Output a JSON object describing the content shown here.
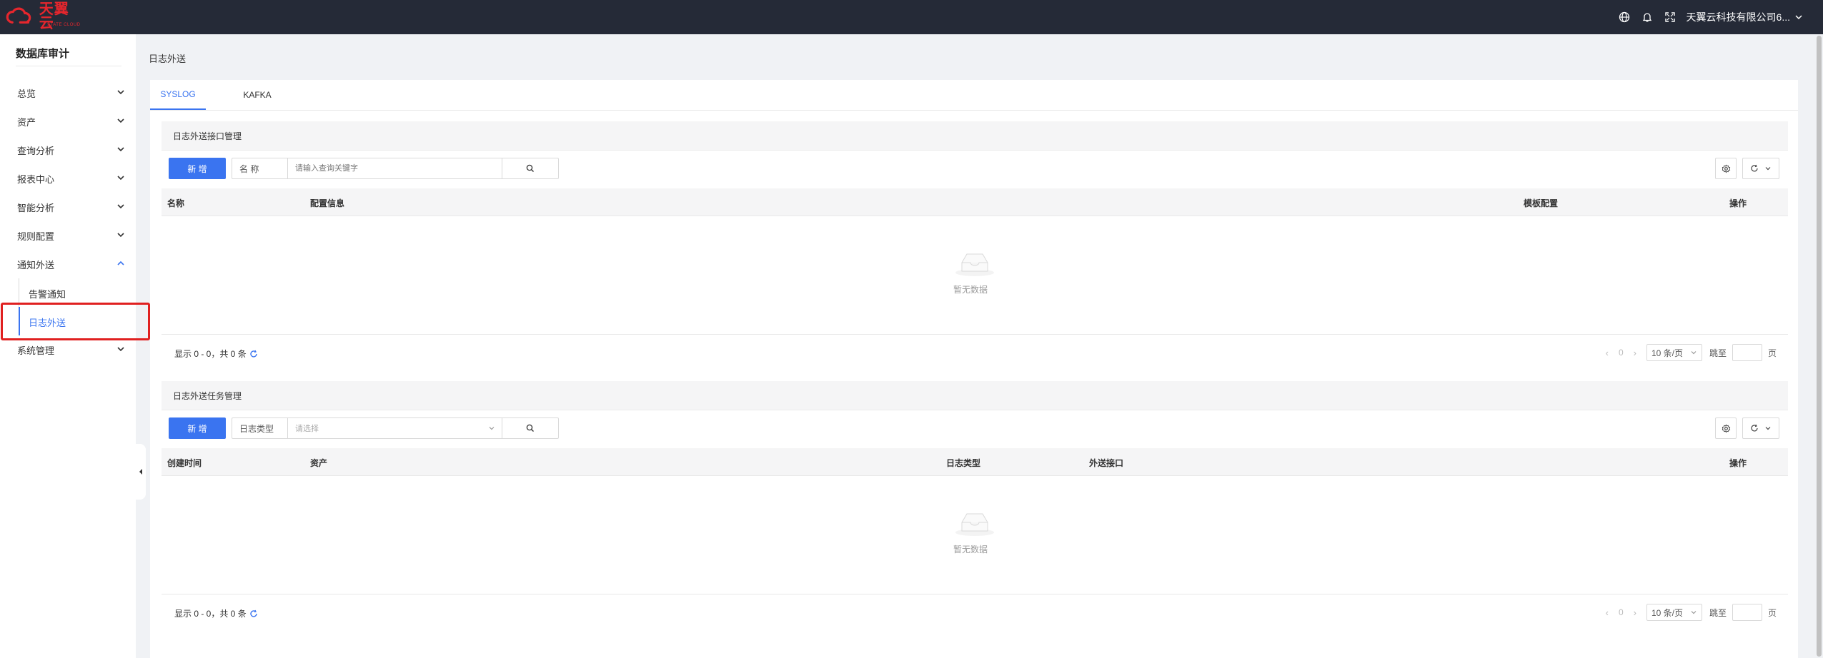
{
  "brand": {
    "name": "天翼云",
    "subtitle": "STATE CLOUD"
  },
  "topbar": {
    "user": "天翼云科技有限公司6...",
    "icons": [
      "globe-icon",
      "bell-icon",
      "fullscreen-icon"
    ]
  },
  "sidebar": {
    "title": "数据库审计",
    "items": [
      {
        "label": "总览"
      },
      {
        "label": "资产"
      },
      {
        "label": "查询分析"
      },
      {
        "label": "报表中心"
      },
      {
        "label": "智能分析"
      },
      {
        "label": "规则配置"
      },
      {
        "label": "通知外送",
        "expanded": true
      },
      {
        "label": "系统管理"
      }
    ],
    "subitems": [
      {
        "label": "告警通知"
      },
      {
        "label": "日志外送",
        "active": true
      }
    ],
    "accent": "#3a74f0",
    "highlight_color": "#e02020"
  },
  "breadcrumb": "日志外送",
  "tabs": [
    {
      "label": "SYSLOG",
      "active": true
    },
    {
      "label": "KAFKA"
    }
  ],
  "panel1": {
    "title": "日志外送接口管理",
    "new_label": "新 增",
    "field_label": "名 称",
    "placeholder": "请输入查询关键字",
    "columns": [
      "名称",
      "配置信息",
      "模板配置",
      "操作"
    ],
    "empty": "暂无数据",
    "summary": "显示 0 - 0，共 0 条",
    "page": "0",
    "page_size": "10 条/页",
    "jump": "跳至",
    "page_unit": "页"
  },
  "panel2": {
    "title": "日志外送任务管理",
    "new_label": "新 增",
    "field_label": "日志类型",
    "placeholder": "请选择",
    "columns": [
      "创建时间",
      "资产",
      "日志类型",
      "外送接口",
      "操作"
    ],
    "empty": "暂无数据",
    "summary": "显示 0 - 0，共 0 条",
    "page": "0",
    "page_size": "10 条/页",
    "jump": "跳至",
    "page_unit": "页"
  }
}
